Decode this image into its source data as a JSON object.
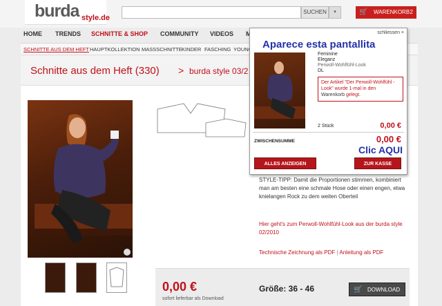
{
  "header": {
    "logo_main": "burda",
    "logo_sub": "style.de",
    "search_button": "SUCHEN",
    "dropdown_arrow": "▾",
    "cart_label": "WARENKORB",
    "cart_count": "2",
    "cart_icon": "cart-icon"
  },
  "nav": {
    "items": [
      "HOME",
      "TRENDS",
      "SCHNITTE & SHOP",
      "COMMUNITY",
      "VIDEOS",
      "M"
    ],
    "active_index": 2,
    "sub_items": [
      "SCHNITTE AUS DEM HEFT",
      "HAUPTKOLLEKTION",
      "MASSSCHNITTE",
      "KINDER",
      "FASCHING",
      "YOUNG"
    ]
  },
  "page": {
    "title": "Schnitte aus dem Heft (330)",
    "crumb_arrow": ">",
    "crumb": "burda style 03/2"
  },
  "product": {
    "style_tip": "STYLE-TIPP: Damit die Proportionen stimmen, kombiniert man am besten eine schmale Hose oder einen engen, etwa knielangen Rock zu dem weiten Oberteil",
    "look_link": "Hier geht's zum Perwoll-Wohlfühl-Look aus der burda style 02/2010",
    "pdf_link1": "Technische Zeichnung als PDF",
    "pdf_sep": "|",
    "pdf_link2": "Anleitung als PDF",
    "price": "0,00 €",
    "price_note": "sofort lieferbar als Download",
    "size": "Größe: 36 - 46",
    "download_label": "DOWNLOAD",
    "download_icon": "cart-icon"
  },
  "popup": {
    "close_label": "schliessen ×",
    "annotation_top": "Aparece esta pantallita",
    "product_name_line1": "Feminine",
    "product_name_line2": "Eleganz",
    "product_name_line3": "Perwoll-Wohlfühl-Look",
    "product_name_line4": "DL",
    "note_prefix": "Der Artikel \"Der Perwoll-Wohlfühl -Look\" wurde 1-mal in den",
    "note_suffix": "Warenkorb",
    "note_end": "gelegt.",
    "quantity": "2 Stück",
    "item_price": "0,00 €",
    "subtotal_label": "ZWISCHENSUMME",
    "subtotal": "0,00 €",
    "annotation_bottom": "Clic AQUI",
    "btn_show_all": "ALLES ANZEIGEN",
    "btn_checkout": "ZUR KASSE"
  },
  "colors": {
    "brand_red": "#c0101a",
    "annotation_blue": "#2432a8"
  }
}
